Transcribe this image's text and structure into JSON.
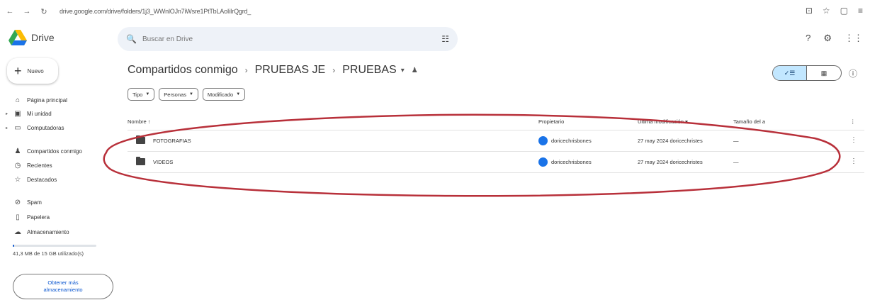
{
  "browser": {
    "url": "drive.google.com/drive/folders/1j3_WWnlOJn7iWsre1PtTbLAoIiIrQgrd_",
    "nav": [
      "←",
      "→",
      "↻"
    ],
    "right_icons": [
      "⊡",
      "☆",
      "▢",
      "≡"
    ]
  },
  "app": {
    "name": "Drive",
    "brand_colors": [
      "#1a73e8",
      "#34a853",
      "#fbbc04"
    ]
  },
  "search": {
    "placeholder": "Buscar en Drive"
  },
  "top_icons": [
    "?",
    "⚙",
    "⋮⋮"
  ],
  "sidebar": {
    "new_label": "Nuevo",
    "items": [
      {
        "label": "Página principal",
        "icon": "home-icon"
      },
      {
        "label": "Mi unidad",
        "icon": "drive-icon"
      },
      {
        "label": "Computadoras",
        "icon": "computer-icon"
      },
      {
        "label": "Compartidos conmigo",
        "icon": "shared-icon"
      },
      {
        "label": "Recientes",
        "icon": "clock-icon"
      },
      {
        "label": "Destacados",
        "icon": "star-icon"
      },
      {
        "label": "Spam",
        "icon": "spam-icon"
      },
      {
        "label": "Papelera",
        "icon": "trash-icon"
      },
      {
        "label": "Almacenamiento",
        "icon": "cloud-icon"
      }
    ],
    "storage_text": "41,3 MB de 15 GB utilizado(s)",
    "storage_used_fraction": 0.003,
    "get_storage_label": "Obtener más almacenamiento"
  },
  "breadcrumb": {
    "root": "Compartidos conmigo",
    "folder1": "PRUEBAS JE",
    "folder2": "PRUEBAS"
  },
  "filters": [
    "Tipo",
    "Personas",
    "Modificado"
  ],
  "table": {
    "headers": {
      "name": "Nombre",
      "owner": "Propietario",
      "modified": "Última modificación",
      "size": "Tamaño del a"
    },
    "rows": [
      {
        "name": "FOTOGRAFIAS",
        "owner": "doricechrisbones",
        "modified": "27 may 2024 doricechristes",
        "size": "—"
      },
      {
        "name": "VIDEOS",
        "owner": "doricechrisbones",
        "modified": "27 may 2024 doricechristes",
        "size": "—"
      }
    ]
  },
  "annotation": {
    "shape": "ellipse",
    "color": "#b8303a"
  }
}
